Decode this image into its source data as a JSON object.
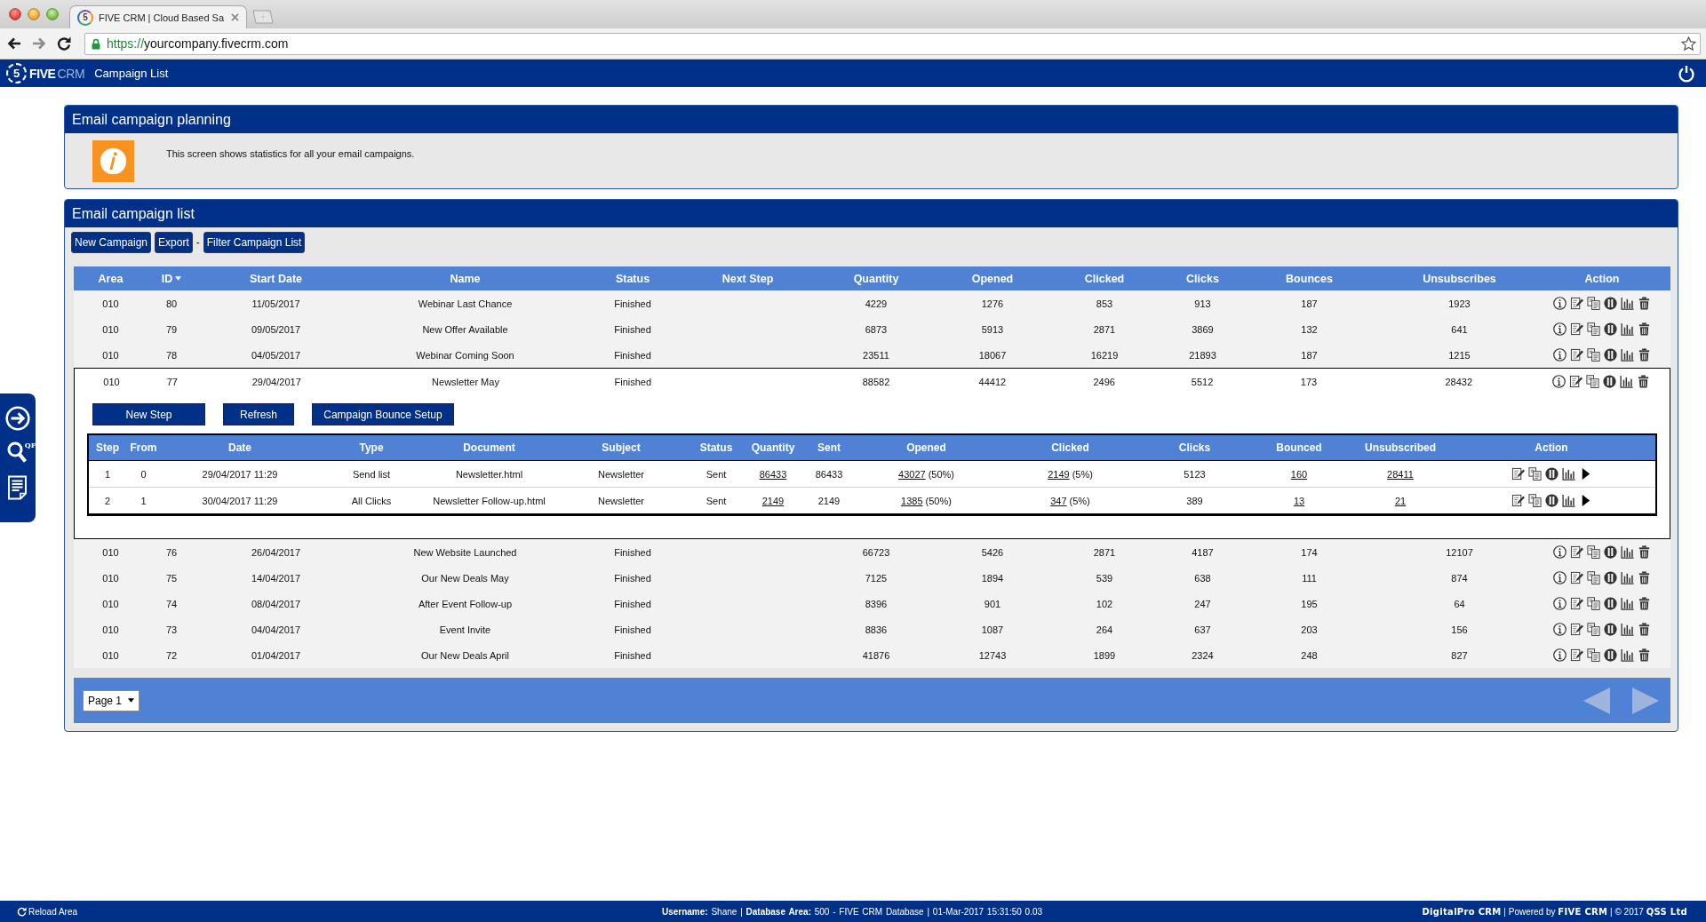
{
  "browser": {
    "favicon_mark": "5",
    "tab_title": "FIVE CRM | Cloud Based Sa",
    "nav": [
      {
        "kind": "back",
        "disabled": false
      },
      {
        "kind": "forward",
        "disabled": true
      },
      {
        "kind": "reload",
        "disabled": false
      }
    ],
    "url": {
      "scheme": "https://",
      "host": "yourcompany.fivecrm.com"
    }
  },
  "app_header": {
    "logo_mark": "5",
    "logo": "**FIVE**CRM",
    "page_title": "Campaign List"
  },
  "sidebar": {
    "buttons": [
      {
        "kind": "next"
      },
      {
        "kind": "search",
        "label": "QF"
      },
      {
        "kind": "notes"
      }
    ]
  },
  "planning_panel": {
    "title": "Email campaign planning",
    "message": "This screen shows statistics for all your email campaigns."
  },
  "list_panel": {
    "title": "Email campaign list",
    "toolbar": [
      {
        "kind": "button",
        "label": "New Campaign"
      },
      {
        "kind": "button",
        "label": "Export"
      },
      {
        "kind": "separator",
        "label": "-"
      },
      {
        "kind": "button",
        "label": "Filter Campaign List"
      }
    ],
    "table": {
      "columns": [
        {
          "label": "Area",
          "sorted": false
        },
        {
          "label": "ID",
          "sorted": true
        },
        {
          "label": "Start Date",
          "sorted": false
        },
        {
          "label": "Name",
          "sorted": false
        },
        {
          "label": "Status",
          "sorted": false
        },
        {
          "label": "Next Step",
          "sorted": false
        },
        {
          "label": "Quantity",
          "sorted": false
        },
        {
          "label": "Opened",
          "sorted": false
        },
        {
          "label": "Clicked",
          "sorted": false
        },
        {
          "label": "Clicks",
          "sorted": false
        },
        {
          "label": "Bounces",
          "sorted": false
        },
        {
          "label": "Unsubscribes",
          "sorted": false
        },
        {
          "label": "Action",
          "sorted": false
        }
      ],
      "rows": [
        {
          "area": "010",
          "id": "80",
          "start_date": "11/05/2017",
          "name": "Webinar Last Chance",
          "status": "Finished",
          "quantity": "4229",
          "opened": "1276",
          "clicked": "853",
          "clicks": "913",
          "bounces": "187",
          "unsubscribes": "1923",
          "expanded": false
        },
        {
          "area": "010",
          "id": "79",
          "start_date": "09/05/2017",
          "name": "New Offer Available",
          "status": "Finished",
          "quantity": "6873",
          "opened": "5913",
          "clicked": "2871",
          "clicks": "3869",
          "bounces": "132",
          "unsubscribes": "641",
          "expanded": false
        },
        {
          "area": "010",
          "id": "78",
          "start_date": "04/05/2017",
          "name": "Webinar Coming Soon",
          "status": "Finished",
          "quantity": "23511",
          "opened": "18067",
          "clicked": "16219",
          "clicks": "21893",
          "bounces": "187",
          "unsubscribes": "1215",
          "expanded": false
        },
        {
          "area": "010",
          "id": "77",
          "start_date": "29/04/2017",
          "name": "Newsletter May",
          "status": "Finished",
          "quantity": "88582",
          "opened": "44412",
          "clicked": "2496",
          "clicks": "5512",
          "bounces": "173",
          "unsubscribes": "28432",
          "expanded": true,
          "detail": {
            "buttons": [
              "New Step",
              "Refresh",
              "Campaign Bounce Setup"
            ],
            "columns": [
              "Step",
              "From",
              "Date",
              "Type",
              "Document",
              "Subject",
              "Status",
              "Quantity",
              "Sent",
              "Opened",
              "Clicked",
              "Clicks",
              "Bounced",
              "Unsubscribed",
              "Action"
            ],
            "steps": [
              {
                "step": "1",
                "from": "0",
                "date": "29/04/2017 11:29",
                "type": "Send list",
                "document": "Newsletter.html",
                "subject": "Newsletter",
                "status": "Sent",
                "quantity": "86433",
                "sent": "86433",
                "opened": {
                  "value": "43027",
                  "note": "(50%)"
                },
                "clicked": {
                  "value": "2149",
                  "note": "(5%)"
                },
                "clicks": "5123",
                "bounced": "160",
                "unsubscribed": "28411"
              },
              {
                "step": "2",
                "from": "1",
                "date": "30/04/2017 11:29",
                "type": "All Clicks",
                "document": "Newsletter Follow-up.html",
                "subject": "Newsletter",
                "status": "Sent",
                "quantity": "2149",
                "sent": "2149",
                "opened": {
                  "value": "1385",
                  "note": "(50%)"
                },
                "clicked": {
                  "value": "347",
                  "note": "(5%)"
                },
                "clicks": "389",
                "bounced": "13",
                "unsubscribed": "21"
              }
            ]
          }
        },
        {
          "area": "010",
          "id": "76",
          "start_date": "26/04/2017",
          "name": "New Website Launched",
          "status": "Finished",
          "quantity": "66723",
          "opened": "5426",
          "clicked": "2871",
          "clicks": "4187",
          "bounces": "174",
          "unsubscribes": "12107",
          "expanded": false
        },
        {
          "area": "010",
          "id": "75",
          "start_date": "14/04/2017",
          "name": "Our New Deals May",
          "status": "Finished",
          "quantity": "7125",
          "opened": "1894",
          "clicked": "539",
          "clicks": "638",
          "bounces": "111",
          "unsubscribes": "874",
          "expanded": false
        },
        {
          "area": "010",
          "id": "74",
          "start_date": "08/04/2017",
          "name": "After Event Follow-up",
          "status": "Finished",
          "quantity": "8396",
          "opened": "901",
          "clicked": "102",
          "clicks": "247",
          "bounces": "195",
          "unsubscribes": "64",
          "expanded": false
        },
        {
          "area": "010",
          "id": "73",
          "start_date": "04/04/2017",
          "name": "Event Invite",
          "status": "Finished",
          "quantity": "8836",
          "opened": "1087",
          "clicked": "264",
          "clicks": "637",
          "bounces": "203",
          "unsubscribes": "156",
          "expanded": false
        },
        {
          "area": "010",
          "id": "72",
          "start_date": "01/04/2017",
          "name": "Our New Deals April",
          "status": "Finished",
          "quantity": "41876",
          "opened": "12743",
          "clicked": "1899",
          "clicks": "2324",
          "bounces": "248",
          "unsubscribes": "827",
          "expanded": false
        }
      ]
    },
    "pagination": {
      "page_select": "Page 1",
      "previous": {
        "disabled": true
      },
      "next": {
        "disabled": true
      }
    }
  },
  "status_bar": {
    "reload": "Reload Area",
    "session": "**Username:** Shane | **Database Area:** 500 - FIVE CRM Database | 01-Mar-2017 15:31:50 0.03",
    "credits": "**DigitalPro CRM** | Powered by **FIVE CRM** | © 2017 **QSS Ltd**"
  }
}
